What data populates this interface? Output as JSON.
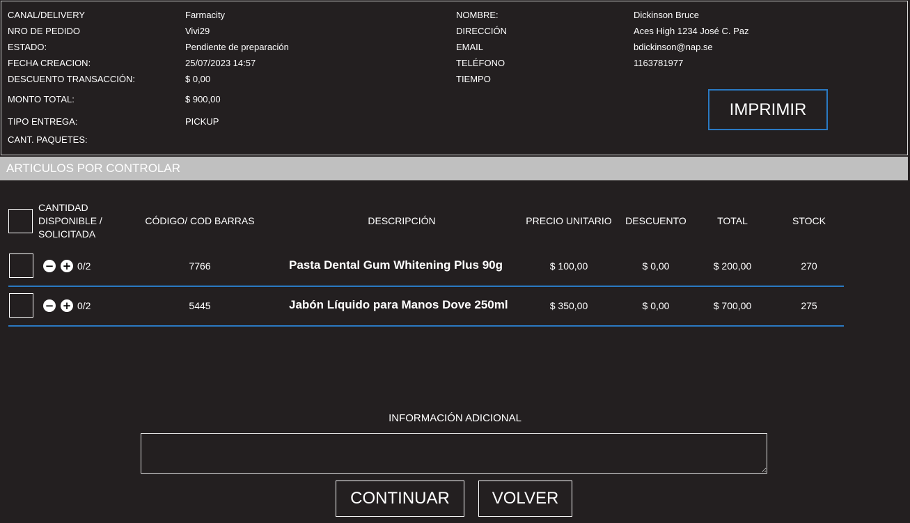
{
  "order": {
    "left_fields": [
      {
        "label": "CANAL/DELIVERY",
        "value": "Farmacity"
      },
      {
        "label": "NRO DE PEDIDO",
        "value": "Vivi29"
      },
      {
        "label": "ESTADO:",
        "value": "Pendiente de preparación"
      },
      {
        "label": "FECHA CREACION:",
        "value": "25/07/2023 14:57"
      },
      {
        "label": "DESCUENTO TRANSACCIÓN:",
        "value": "$ 0,00"
      },
      {
        "label": "MONTO TOTAL:",
        "value": "$ 900,00"
      },
      {
        "label": "TIPO ENTREGA:",
        "value": "PICKUP"
      },
      {
        "label": "CANT. PAQUETES:",
        "value": ""
      }
    ],
    "right_fields": [
      {
        "label": "NOMBRE:",
        "value": "Dickinson Bruce"
      },
      {
        "label": "DIRECCIÓN",
        "value": "Aces High 1234 José C. Paz"
      },
      {
        "label": "EMAIL",
        "value": "bdickinson@nap.se"
      },
      {
        "label": "TELÉFONO",
        "value": "1163781977"
      },
      {
        "label": "TIEMPO",
        "value": ""
      }
    ],
    "print_label": "IMPRIMIR"
  },
  "section": {
    "title": "ARTICULOS POR CONTROLAR"
  },
  "table": {
    "headers": {
      "cantidad_line1": "CANTIDAD",
      "cantidad_line2": "DISPONIBLE /",
      "cantidad_line3": "SOLICITADA",
      "codigo": "CÓDIGO/ COD BARRAS",
      "descripcion": "DESCRIPCIÓN",
      "precio": "PRECIO UNITARIO",
      "descuento": "DESCUENTO",
      "total": "TOTAL",
      "stock": "STOCK"
    },
    "rows": [
      {
        "qty": "0/2",
        "codigo": "7766",
        "descripcion": "Pasta Dental Gum Whitening Plus 90g",
        "precio": "$ 100,00",
        "descuento": "$ 0,00",
        "total": "$ 200,00",
        "stock": "270"
      },
      {
        "qty": "0/2",
        "codigo": "5445",
        "descripcion": "Jabón Líquido para Manos Dove 250ml",
        "precio": "$ 350,00",
        "descuento": "$ 0,00",
        "total": "$ 700,00",
        "stock": "275"
      }
    ]
  },
  "additional": {
    "label": "INFORMACIÓN ADICIONAL",
    "value": ""
  },
  "actions": {
    "continue_label": "CONTINUAR",
    "back_label": "VOLVER"
  },
  "colors": {
    "background": "#231f20",
    "accent": "#2a79c2",
    "section_bar": "#c0c0c0"
  },
  "icons": {
    "minus": "minus-circle-icon",
    "plus": "plus-circle-icon"
  }
}
